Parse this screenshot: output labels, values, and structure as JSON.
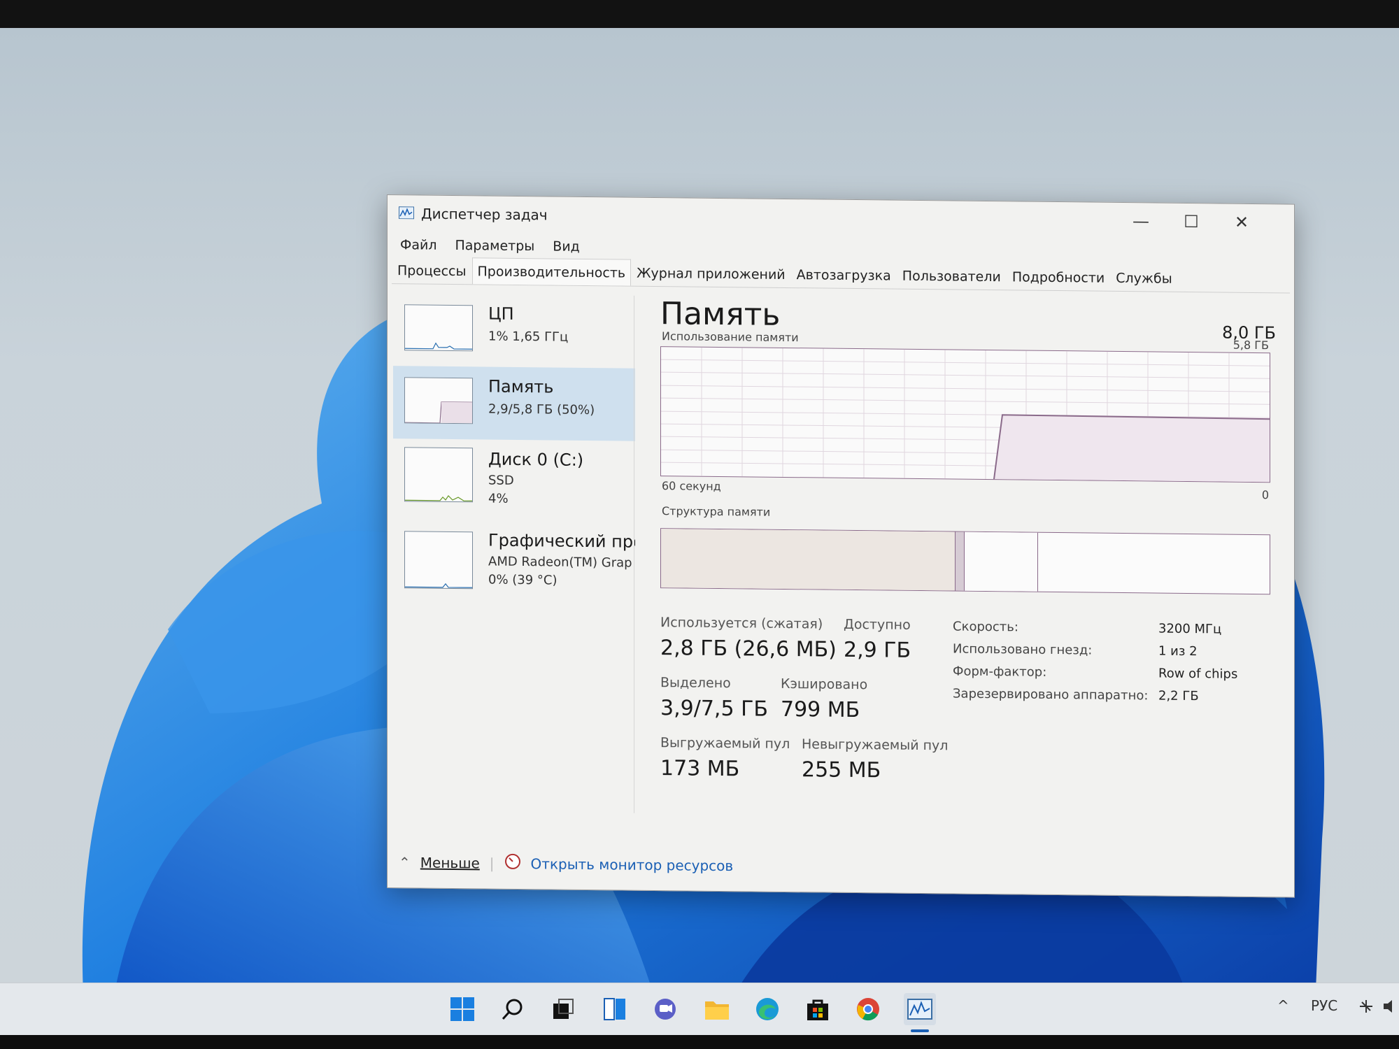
{
  "window": {
    "title": "Диспетчер задач",
    "minimize_glyph": "—",
    "maximize_glyph": "☐",
    "close_glyph": "✕"
  },
  "menu": [
    "Файл",
    "Параметры",
    "Вид"
  ],
  "tabs": [
    "Процессы",
    "Производительность",
    "Журнал приложений",
    "Автозагрузка",
    "Пользователи",
    "Подробности",
    "Службы"
  ],
  "active_tab": "Производительность",
  "sidebar": {
    "items": [
      {
        "name": "ЦП",
        "sub1": "1%  1,65 ГГц",
        "sub2": ""
      },
      {
        "name": "Память",
        "sub1": "2,9/5,8 ГБ (50%)",
        "sub2": ""
      },
      {
        "name": "Диск 0 (C:)",
        "sub1": "SSD",
        "sub2": "4%"
      },
      {
        "name": "Графический про",
        "sub1": "AMD Radeon(TM) Grap",
        "sub2": "0%  (39 °C)"
      }
    ]
  },
  "main": {
    "title": "Память",
    "total": "8,0 ГБ",
    "graph_label": "Использование памяти",
    "graph_max": "5,8 ГБ",
    "graph_left": "60 секунд",
    "graph_right": "0",
    "structure_label": "Структура памяти",
    "usage_fraction": 0.5
  },
  "stats": {
    "in_use_label": "Используется (сжатая)",
    "in_use_value": "2,8 ГБ (26,6 МБ)",
    "available_label": "Доступно",
    "available_value": "2,9 ГБ",
    "committed_label": "Выделено",
    "committed_value": "3,9/7,5 ГБ",
    "cached_label": "Кэшировано",
    "cached_value": "799 МБ",
    "paged_label": "Выгружаемый пул",
    "paged_value": "173 МБ",
    "nonpaged_label": "Невыгружаемый пул",
    "nonpaged_value": "255 МБ"
  },
  "details": [
    {
      "label": "Скорость:",
      "value": "3200 МГц"
    },
    {
      "label": "Использовано гнезд:",
      "value": "1 из 2"
    },
    {
      "label": "Форм-фактор:",
      "value": "Row of chips"
    },
    {
      "label": "Зарезервировано аппаратно:",
      "value": "2,2 ГБ"
    }
  ],
  "footer": {
    "less_label": "Меньше",
    "resource_monitor_label": "Открыть монитор ресурсов"
  },
  "taskbar": {
    "icons": [
      "windows-start-icon",
      "search-icon",
      "task-view-icon",
      "widgets-icon",
      "chat-icon",
      "file-explorer-icon",
      "edge-icon",
      "store-icon",
      "chrome-icon",
      "task-manager-icon"
    ],
    "tray_lang": "РУС",
    "tray_chevron": "^"
  },
  "colors": {
    "accent": "#1a5fb4",
    "selected_item": "#cfe0ee",
    "memory_graph": "#8a6a8a"
  }
}
